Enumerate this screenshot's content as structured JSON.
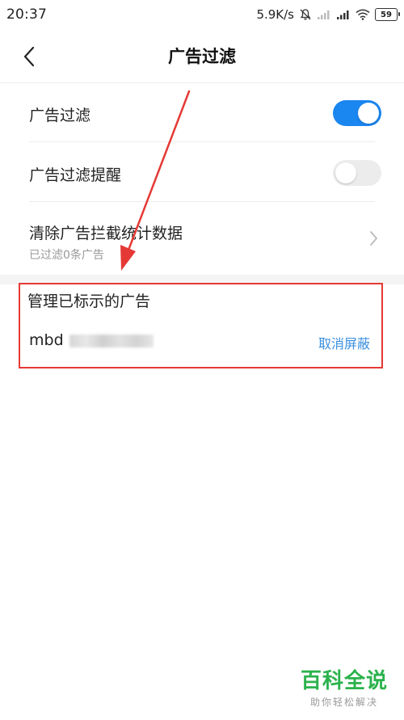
{
  "status_bar": {
    "time": "20:37",
    "net_speed": "5.9K/s",
    "battery": "59"
  },
  "header": {
    "title": "广告过滤",
    "back_icon": "chevron-left-icon"
  },
  "settings": {
    "ad_filter": {
      "label": "广告过滤",
      "enabled": true
    },
    "ad_filter_reminder": {
      "label": "广告过滤提醒",
      "enabled": false
    },
    "clear_stats": {
      "label": "清除广告拦截统计数据",
      "sub": "已过滤0条广告"
    }
  },
  "managed_ads": {
    "title": "管理已标示的广告",
    "items": [
      {
        "name": "mbd",
        "action": "取消屏蔽"
      }
    ]
  },
  "watermark": {
    "main": "百科全说",
    "sub": "助你轻松解决"
  },
  "colors": {
    "accent": "#1a86f0",
    "link": "#3a8fe0",
    "annotation": "#e53935",
    "watermark": "#2bb24c"
  }
}
